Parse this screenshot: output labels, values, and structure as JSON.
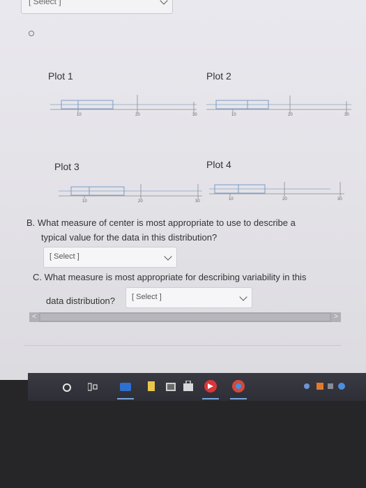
{
  "top_select": {
    "label": "[ Select ]"
  },
  "plots": [
    {
      "title": "Plot 1",
      "ticks": [
        "10",
        "20",
        "30"
      ]
    },
    {
      "title": "Plot 2",
      "ticks": [
        "10",
        "20",
        "30"
      ]
    },
    {
      "title": "Plot 3",
      "ticks": [
        "10",
        "20",
        "30"
      ]
    },
    {
      "title": "Plot 4",
      "ticks": [
        "10",
        "20",
        "30"
      ]
    }
  ],
  "question_b": {
    "line1": "B. What measure of center is most appropriate to use to describe a",
    "line2": "typical value for the data in this distribution?",
    "select_label": "[ Select ]"
  },
  "question_c": {
    "line1": "C. What measure is most appropriate for describing variability in this",
    "line2": "data distribution?",
    "select_label": "[ Select ]"
  },
  "scrollbar": {
    "left_arrow": "<",
    "right_arrow": ">"
  },
  "colors": {
    "page_bg": "#e6e5ea",
    "plot_line": "#7a9bc4",
    "taskbar": "#34343c"
  }
}
